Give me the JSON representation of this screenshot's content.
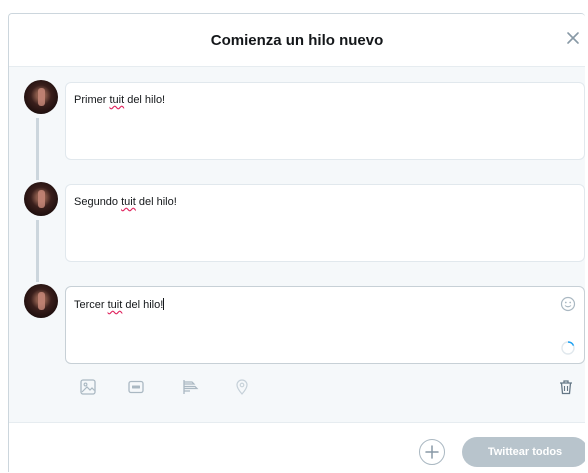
{
  "dialog": {
    "title": "Comienza un hilo nuevo"
  },
  "tweets": [
    {
      "before": "Primer ",
      "misspelled": "tuit",
      "after": " del hilo!"
    },
    {
      "before": "Segundo ",
      "misspelled": "tuit",
      "after": " del hilo!"
    },
    {
      "before": "Tercer ",
      "misspelled": "tuit",
      "after": " del hilo!"
    }
  ],
  "toolbar": {
    "icons": [
      "image-icon",
      "gif-icon",
      "poll-icon",
      "location-icon",
      "delete-icon"
    ]
  },
  "footer": {
    "tweet_all_label": "Twittear todos"
  },
  "colors": {
    "icon": "#aab8c2",
    "disabled_button": "#b8c4cc",
    "spinner": "#1da1f2",
    "spellcheck": "#e0245e"
  }
}
